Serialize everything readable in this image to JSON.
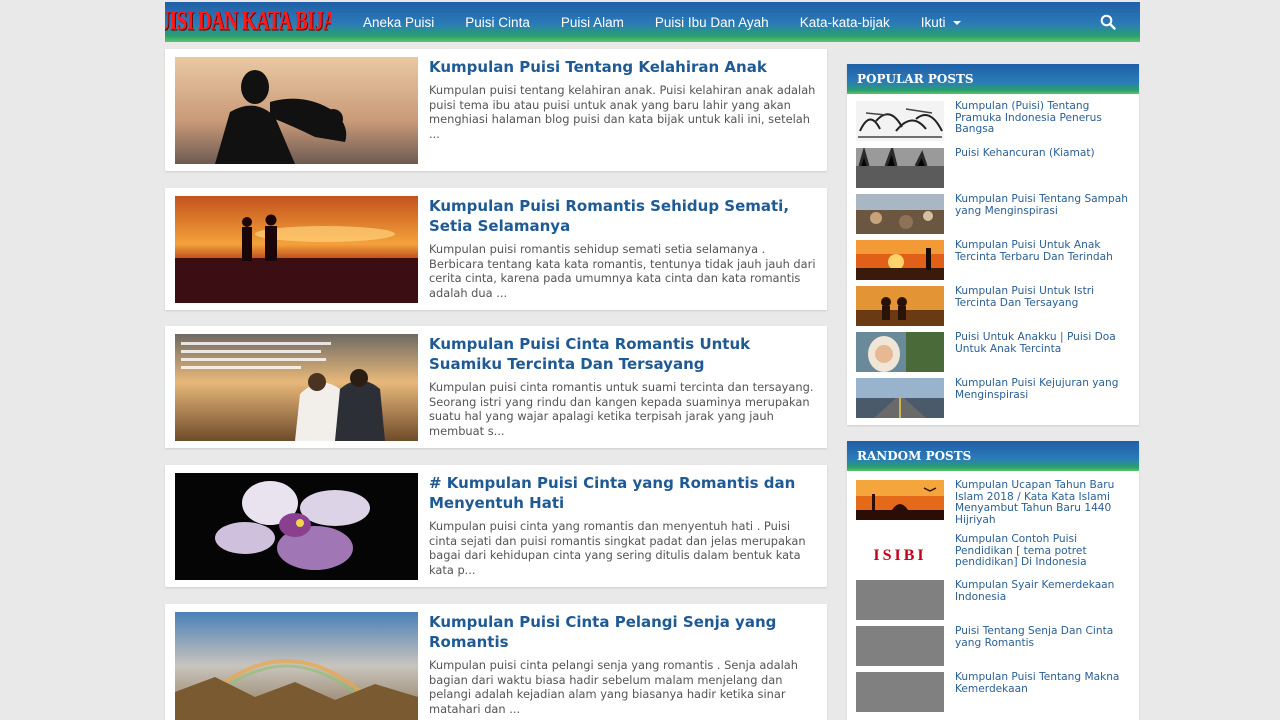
{
  "site": {
    "logo_text": "PUISI DAN KATA BIJAK"
  },
  "nav": {
    "items": [
      {
        "label": "Aneka Puisi"
      },
      {
        "label": "Puisi Cinta"
      },
      {
        "label": "Puisi Alam"
      },
      {
        "label": "Puisi Ibu Dan Ayah"
      },
      {
        "label": "Kata-kata-bijak"
      },
      {
        "label": "Ikuti"
      }
    ],
    "search_icon": "search-icon"
  },
  "posts": [
    {
      "title": "Kumpulan Puisi Tentang Kelahiran Anak",
      "excerpt": "Kumpulan puisi tentang kelahiran anak. Puisi kelahiran anak adalah puisi tema ibu atau puisi untuk anak yang baru lahir yang akan menghiasi halaman blog puisi dan kata bijak untuk kali ini, setelah ..."
    },
    {
      "title": "Kumpulan Puisi Romantis Sehidup Semati, Setia Selamanya",
      "excerpt": "Kumpulan puisi romantis sehidup semati setia selamanya . Berbicara tentang kata kata romantis, tentunya tidak jauh jauh dari cerita cinta, karena pada umumnya kata cinta dan kata romantis adalah dua ..."
    },
    {
      "title": "Kumpulan Puisi Cinta Romantis Untuk Suamiku Tercinta Dan Tersayang",
      "excerpt": "Kumpulan puisi cinta romantis untuk suami tercinta dan tersayang. Seorang istri yang rindu dan kangen kepada suaminya merupakan suatu hal yang wajar apalagi ketika terpisah jarak yang jauh membuat s..."
    },
    {
      "title": "# Kumpulan Puisi Cinta yang Romantis dan Menyentuh Hati",
      "excerpt": "Kumpulan puisi cinta yang romantis dan menyentuh hati . Puisi cinta sejati dan puisi romantis singkat padat dan jelas merupakan bagai dari kehidupan cinta yang sering ditulis dalam bentuk kata kata p..."
    },
    {
      "title": "Kumpulan Puisi Cinta Pelangi Senja yang Romantis",
      "excerpt": "Kumpulan puisi cinta pelangi senja yang romantis . Senja adalah bagian dari waktu biasa hadir sebelum malam menjelang dan pelangi adalah kejadian alam yang biasanya hadir ketika sinar matahari dan ..."
    }
  ],
  "popular": {
    "heading": "POPULAR POSTS",
    "items": [
      {
        "title": "Kumpulan (Puisi) Tentang Pramuka Indonesia Penerus Bangsa"
      },
      {
        "title": "Puisi Kehancuran (Kiamat)"
      },
      {
        "title": "Kumpulan Puisi Tentang Sampah yang Menginspirasi"
      },
      {
        "title": "Kumpulan Puisi Untuk Anak Tercinta Terbaru Dan Terindah"
      },
      {
        "title": "Kumpulan Puisi Untuk Istri Tercinta Dan Tersayang"
      },
      {
        "title": "Puisi Untuk Anakku | Puisi Doa Untuk Anak Tercinta"
      },
      {
        "title": "Kumpulan Puisi Kejujuran yang Menginspirasi"
      }
    ]
  },
  "random": {
    "heading": "RANDOM POSTS",
    "thumb_text": "ISIBI",
    "items": [
      {
        "title": "Kumpulan Ucapan Tahun Baru Islam 2018 / Kata Kata Islami Menyambut Tahun Baru 1440 Hijriyah"
      },
      {
        "title": "Kumpulan Contoh Puisi Pendidikan [ tema potret pendidikan] Di Indonesia"
      },
      {
        "title": "Kumpulan Syair Kemerdekaan Indonesia"
      },
      {
        "title": "Puisi Tentang Senja Dan Cinta yang Romantis"
      },
      {
        "title": "Kumpulan Puisi Tentang Makna Kemerdekaan"
      }
    ]
  }
}
